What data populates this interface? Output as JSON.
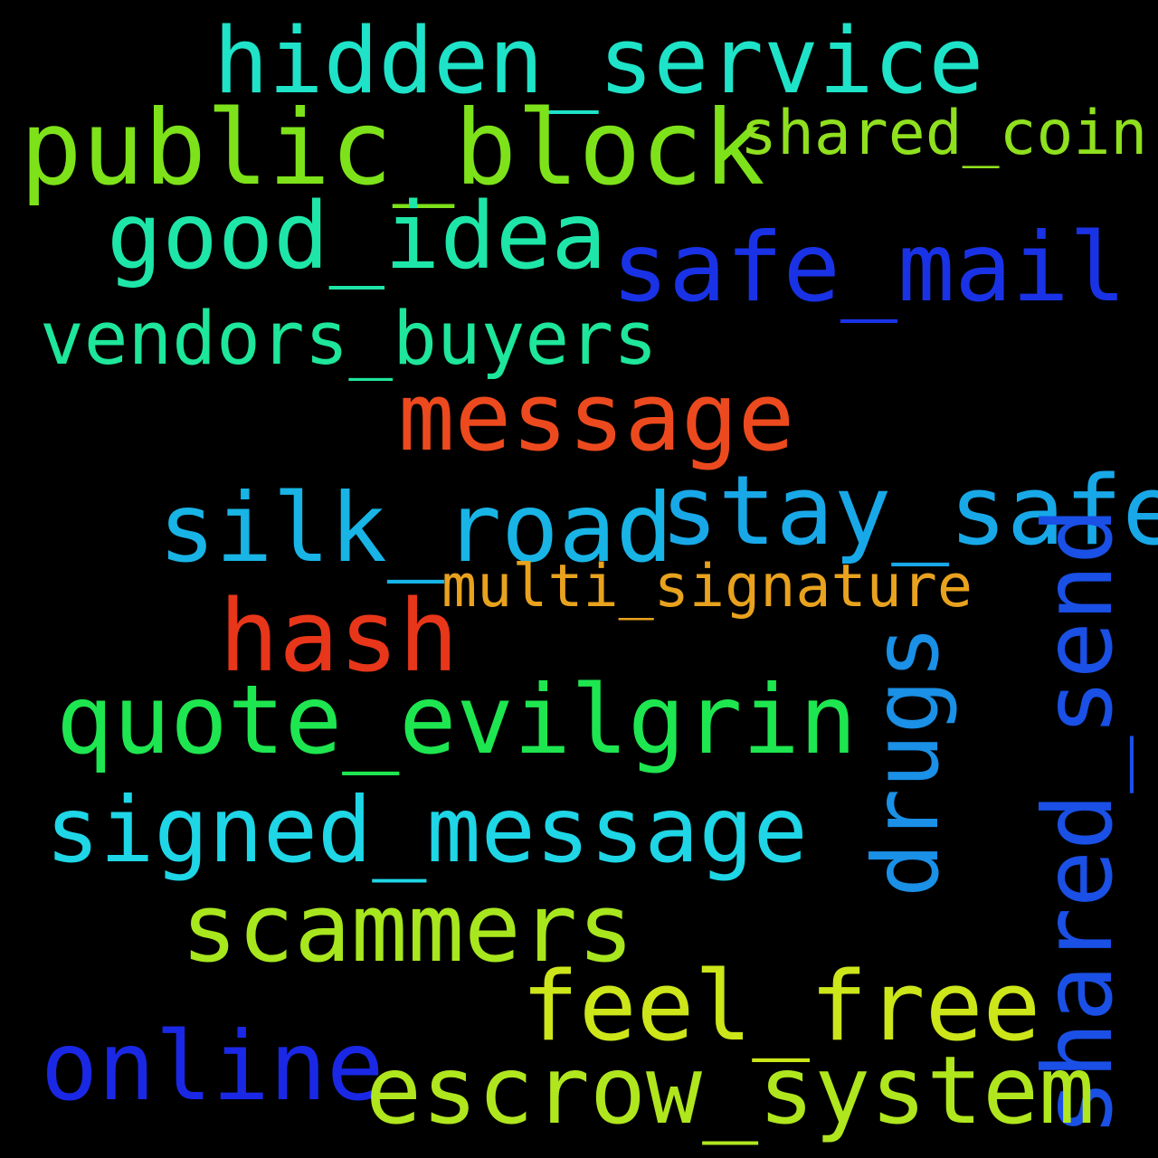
{
  "words": [
    {
      "text": "hidden_service",
      "color": "#1ee3c8"
    },
    {
      "text": "public_block",
      "color": "#7ee21a"
    },
    {
      "text": "shared_coin",
      "color": "#8fe01e"
    },
    {
      "text": "good_idea",
      "color": "#1ee6a8"
    },
    {
      "text": "safe_mail",
      "color": "#1a32e6"
    },
    {
      "text": "vendors_buyers",
      "color": "#1ee69a"
    },
    {
      "text": "message",
      "color": "#ec4a1e"
    },
    {
      "text": "silk_road",
      "color": "#18b4e6"
    },
    {
      "text": "stay_safe",
      "color": "#18a8e8"
    },
    {
      "text": "multi_signature",
      "color": "#e8a21e"
    },
    {
      "text": "hash",
      "color": "#e8361a"
    },
    {
      "text": "quote_evilgrin",
      "color": "#1ee650"
    },
    {
      "text": "drugs",
      "color": "#1a90e6"
    },
    {
      "text": "shared_send",
      "color": "#1a50e6"
    },
    {
      "text": "signed_message",
      "color": "#1ed6e6"
    },
    {
      "text": "scammers",
      "color": "#a8e61e"
    },
    {
      "text": "feel_free",
      "color": "#cce61a"
    },
    {
      "text": "online",
      "color": "#1a28e6"
    },
    {
      "text": "escrow_system",
      "color": "#b0e61e"
    }
  ]
}
